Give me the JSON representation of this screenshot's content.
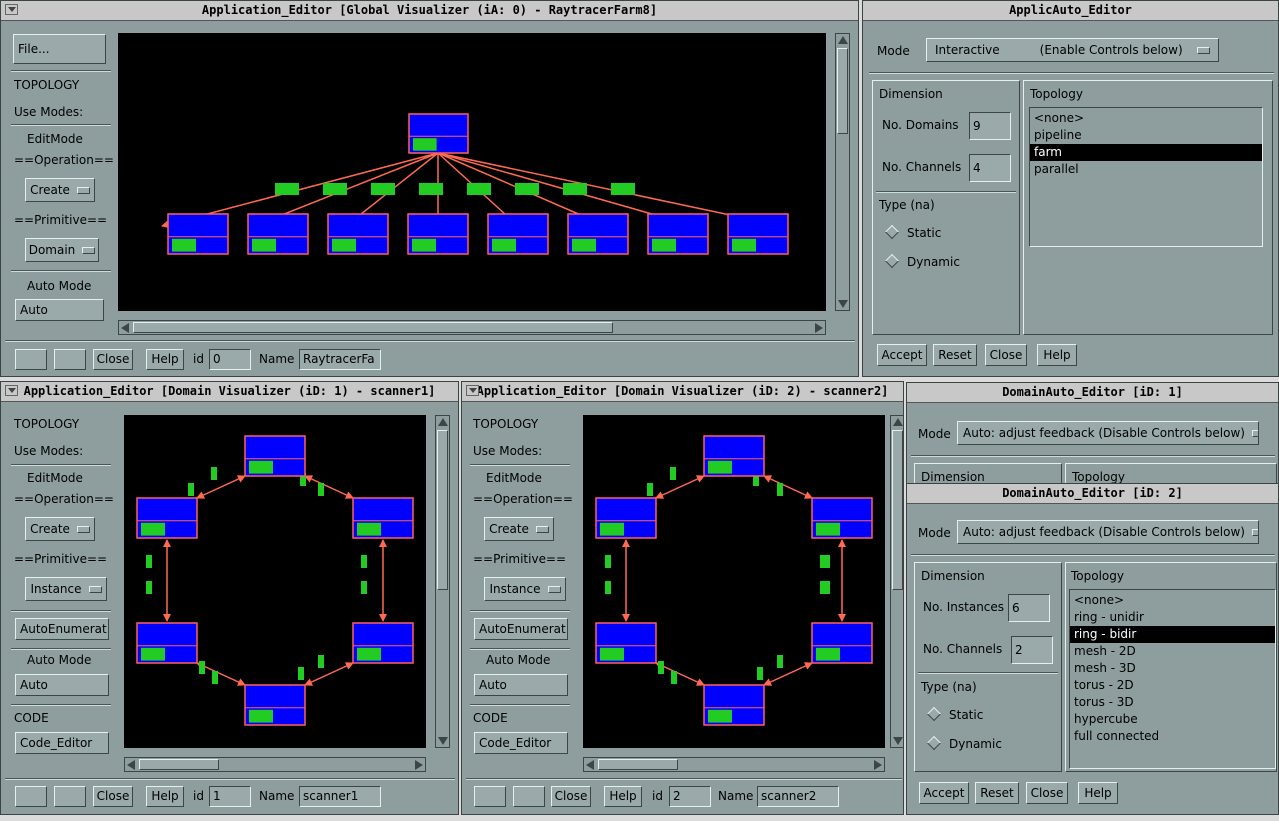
{
  "global_editor": {
    "title": "Application_Editor [Global Visualizer (iA: 0) - RaytracerFarm8]",
    "file_label": "File...",
    "topology_label": "TOPOLOGY",
    "use_modes_label": "Use Modes:",
    "edit_mode_label": "EditMode",
    "operation_label": "==Operation==",
    "operation_value": "Create",
    "primitive_label": "==Primitive==",
    "primitive_value": "Domain",
    "auto_mode_label": "Auto Mode",
    "auto_button_label": "Auto",
    "close_label": "Close",
    "help_label": "Help",
    "id_label": "id",
    "id_value": "0",
    "name_label": "Name",
    "name_value": "RaytracerFa"
  },
  "applic_auto_editor": {
    "title": "ApplicAuto_Editor",
    "mode_label": "Mode",
    "mode_value": "Interactive",
    "mode_hint": "(Enable  Controls below)",
    "dimension_label": "Dimension",
    "domains_label": "No. Domains",
    "domains_value": "9",
    "channels_label": "No. Channels",
    "channels_value": "4",
    "type_label": "Type (na)",
    "static_label": "Static",
    "dynamic_label": "Dynamic",
    "topology_label": "Topology",
    "topology_items": [
      "<none>",
      "pipeline",
      "farm",
      "parallel"
    ],
    "accept_label": "Accept",
    "reset_label": "Reset",
    "close_label": "Close",
    "help_label": "Help"
  },
  "domain_editor_1": {
    "title": "Application_Editor [Domain Visualizer (iD: 1) - scanner1]",
    "topology_label": "TOPOLOGY",
    "use_modes_label": "Use Modes:",
    "edit_mode_label": "EditMode",
    "operation_label": "==Operation==",
    "operation_value": "Create",
    "primitive_label": "==Primitive==",
    "primitive_value": "Instance",
    "auto_enumerate_label": "AutoEnumerat",
    "auto_mode_label": "Auto Mode",
    "auto_button_label": "Auto",
    "code_label": "CODE",
    "code_editor_label": "Code_Editor",
    "close_label": "Close",
    "help_label": "Help",
    "id_label": "id",
    "id_value": "1",
    "name_label": "Name",
    "name_value": "scanner1"
  },
  "domain_editor_2": {
    "title": "Application_Editor [Domain Visualizer (iD: 2) - scanner2]",
    "topology_label": "TOPOLOGY",
    "use_modes_label": "Use Modes:",
    "edit_mode_label": "EditMode",
    "operation_label": "==Operation==",
    "operation_value": "Create",
    "primitive_label": "==Primitive==",
    "primitive_value": "Instance",
    "auto_enumerate_label": "AutoEnumerat",
    "auto_mode_label": "Auto Mode",
    "auto_button_label": "Auto",
    "code_label": "CODE",
    "code_editor_label": "Code_Editor",
    "close_label": "Close",
    "help_label": "Help",
    "id_label": "id",
    "id_value": "2",
    "name_label": "Name",
    "name_value": "scanner2"
  },
  "domain_auto_1": {
    "title": "DomainAuto_Editor [iD: 1]",
    "mode_label": "Mode",
    "mode_value": "Auto: adjust feedback  (Disable Controls below)",
    "dimension_label": "Dimension",
    "topology_label": "Topology"
  },
  "domain_auto_2": {
    "title": "DomainAuto_Editor [iD: 2]",
    "mode_label": "Mode",
    "mode_value": "Auto: adjust feedback  (Disable Controls below)",
    "dimension_label": "Dimension",
    "instances_label": "No. Instances",
    "instances_value": "6",
    "channels_label": "No. Channels",
    "channels_value": "2",
    "type_label": "Type (na)",
    "static_label": "Static",
    "dynamic_label": "Dynamic",
    "topology_label": "Topology",
    "topology_items": [
      "<none>",
      "ring - unidir",
      "ring - bidir",
      "mesh - 2D",
      "mesh - 3D",
      "torus - 2D",
      "torus - 3D",
      "hypercube",
      "full connected"
    ],
    "accept_label": "Accept",
    "reset_label": "Reset",
    "close_label": "Close",
    "help_label": "Help"
  },
  "colors": {
    "canvas": "#000000",
    "node": "#0000ff",
    "node_border": "#ff6060",
    "edge": "#ff6a50",
    "channel": "#22cc22"
  }
}
